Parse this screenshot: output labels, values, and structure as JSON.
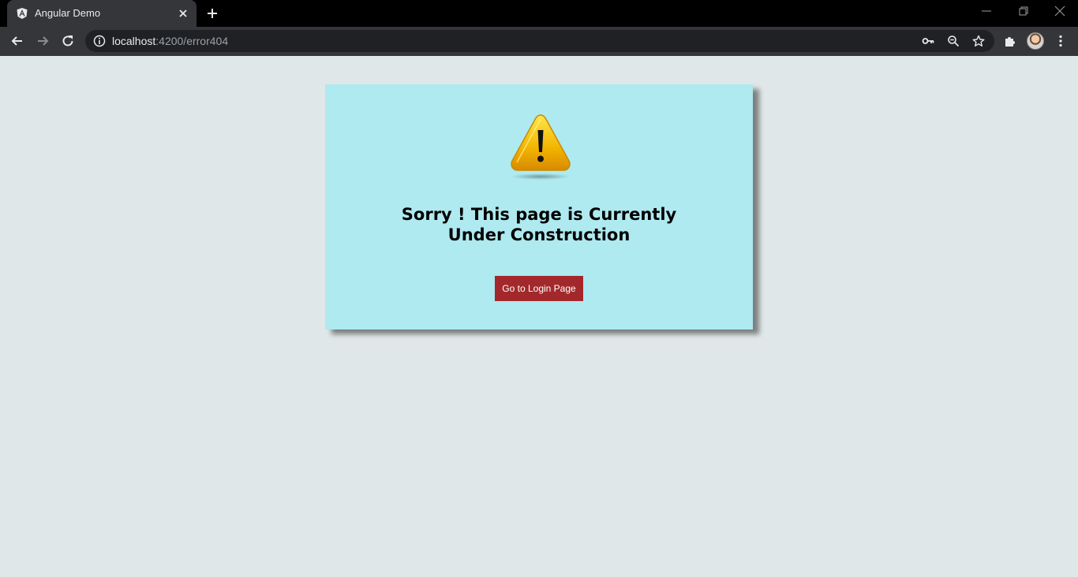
{
  "browser": {
    "tab": {
      "title": "Angular Demo",
      "favicon": "angular-icon"
    },
    "url": {
      "host": "localhost",
      "path": ":4200/error404"
    },
    "toolbar_icons": [
      "back-icon",
      "forward-icon",
      "reload-icon",
      "info-icon",
      "key-icon",
      "zoom-out-icon",
      "star-icon",
      "extensions-icon",
      "profile-avatar",
      "menu-icon"
    ],
    "window_buttons": [
      "minimize-icon",
      "restore-icon",
      "close-icon"
    ]
  },
  "page": {
    "warning_icon": "warning-icon",
    "headline": "Sorry ! This page is Currently Under Construction",
    "button_label": "Go to Login Page",
    "colors": {
      "page_bg": "#e0e7e8",
      "card_bg": "#aeeaf0",
      "button_bg": "#a3282b"
    }
  }
}
